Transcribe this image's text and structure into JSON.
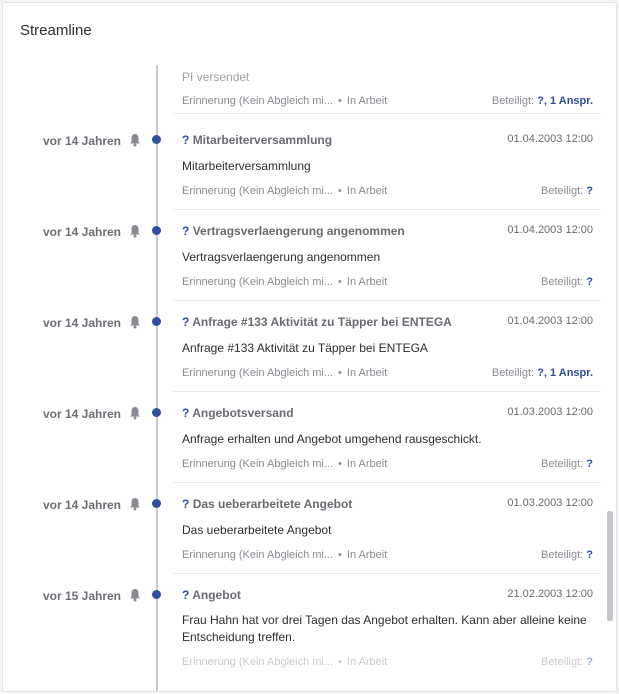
{
  "panel": {
    "title": "Streamline"
  },
  "top_partial": {
    "body": "PI versendet",
    "meta_type": "Erinnerung (Kein Abgleich mi...",
    "meta_status": "In Arbeit",
    "involved_label": "Beteiligt:",
    "involved_value": "?, 1 Anspr."
  },
  "entries": [
    {
      "time": "vor 14 Jahren",
      "title_q": "?",
      "title": "Mitarbeiterversammlung",
      "date": "01.04.2003 12:00",
      "body": "Mitarbeiterversammlung",
      "meta_type": "Erinnerung (Kein Abgleich mi...",
      "meta_status": "In Arbeit",
      "involved_label": "Beteiligt:",
      "involved_value": "?"
    },
    {
      "time": "vor 14 Jahren",
      "title_q": "?",
      "title": "Vertragsverlaengerung angenommen",
      "date": "01.04.2003 12:00",
      "body": "Vertragsverlaengerung angenommen",
      "meta_type": "Erinnerung (Kein Abgleich mi...",
      "meta_status": "In Arbeit",
      "involved_label": "Beteiligt:",
      "involved_value": "?"
    },
    {
      "time": "vor 14 Jahren",
      "title_q": "?",
      "title": "Anfrage #133 Aktivität zu Täpper bei ENTEGA",
      "date": "01.04.2003 12:00",
      "body": "Anfrage #133 Aktivität zu Täpper bei ENTEGA",
      "meta_type": "Erinnerung (Kein Abgleich mi...",
      "meta_status": "In Arbeit",
      "involved_label": "Beteiligt:",
      "involved_value": "?, 1 Anspr."
    },
    {
      "time": "vor 14 Jahren",
      "title_q": "?",
      "title": "Angebotsversand",
      "date": "01.03.2003 12:00",
      "body": "Anfrage erhalten und Angebot umgehend rausgeschickt.",
      "meta_type": "Erinnerung (Kein Abgleich mi...",
      "meta_status": "In Arbeit",
      "involved_label": "Beteiligt:",
      "involved_value": "?"
    },
    {
      "time": "vor 14 Jahren",
      "title_q": "?",
      "title": "Das ueberarbeitete Angebot",
      "date": "01.03.2003 12:00",
      "body": "Das ueberarbeitete Angebot",
      "meta_type": "Erinnerung (Kein Abgleich mi...",
      "meta_status": "In Arbeit",
      "involved_label": "Beteiligt:",
      "involved_value": "?"
    },
    {
      "time": "vor 15 Jahren",
      "title_q": "?",
      "title": "Angebot",
      "date": "21.02.2003 12:00",
      "body": "Frau Hahn hat vor drei Tagen das Angebot erhalten. Kann aber alleine keine Entscheidung treffen.",
      "meta_type": "Erinnerung (Kein Abgleich mi...",
      "meta_status": "In Arbeit",
      "involved_label": "Beteiligt:",
      "involved_value": "?"
    }
  ],
  "separator": "•",
  "icons": {
    "bell": "bell-icon",
    "dot": "timeline-dot"
  },
  "colors": {
    "accent": "#2e4fa0",
    "muted": "#8a8a92",
    "line": "#c9c9cf"
  }
}
